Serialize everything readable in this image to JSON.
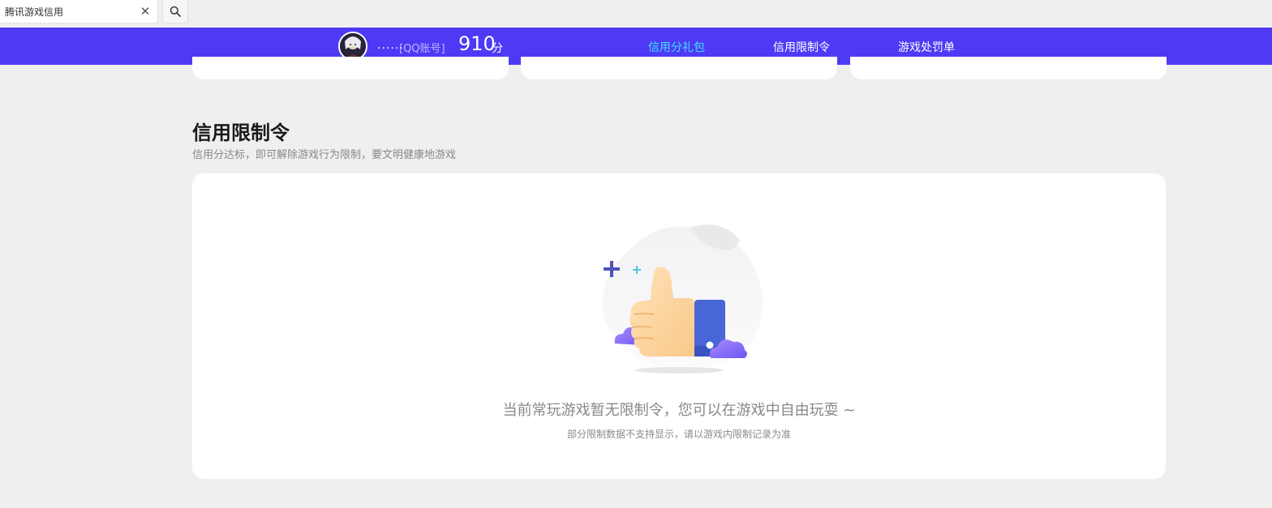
{
  "search": {
    "value": "腾讯游戏信用",
    "clear_glyph": "✕"
  },
  "header": {
    "user_name": "......",
    "account_type": "[QQ账号]",
    "score": "910",
    "score_unit": "分",
    "nav": [
      {
        "label": "信用分礼包",
        "active": true
      },
      {
        "label": "信用限制令",
        "active": false
      },
      {
        "label": "游戏处罚单",
        "active": false
      }
    ]
  },
  "section": {
    "title": "信用限制令",
    "subtitle": "信用分达标，即可解除游戏行为限制，要文明健康地游戏"
  },
  "empty_state": {
    "message": "当前常玩游戏暂无限制令，您可以在游戏中自由玩耍 ~",
    "note": "部分限制数据不支持显示，请以游戏内限制记录为准"
  },
  "colors": {
    "header_bg": "#4e3af5",
    "nav_active": "#3fe0ff",
    "page_bg": "#efefef"
  },
  "icons": [
    "search-icon",
    "close-icon",
    "thumbs-up-illustration"
  ]
}
